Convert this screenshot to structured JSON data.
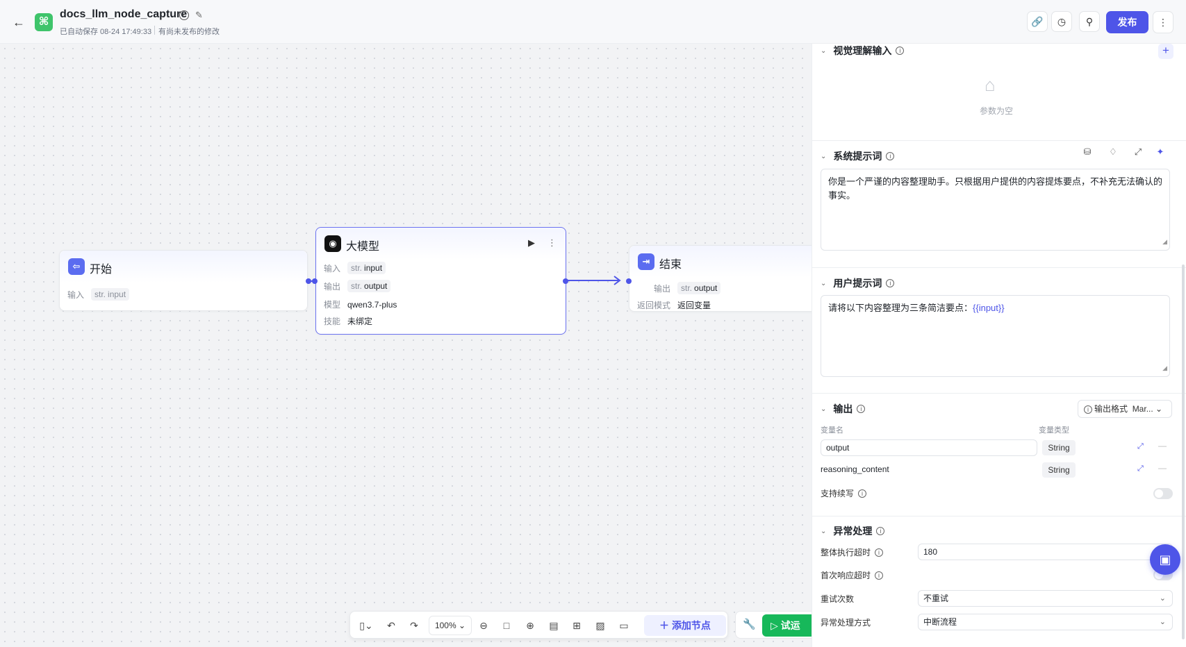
{
  "header": {
    "title": "docs_llm_node_capture",
    "save_status": "已自动保存 08-24 17:49:33",
    "unpublished": "有尚未发布的修改",
    "publish_label": "发布"
  },
  "nodes": {
    "start": {
      "title": "开始",
      "input_label": "输入",
      "input_type": "str.",
      "input_name": "input"
    },
    "llm": {
      "title": "大模型",
      "input_label": "输入",
      "input_type": "str.",
      "input_name": "input",
      "output_label": "输出",
      "output_type": "str.",
      "output_name": "output",
      "model_label": "模型",
      "model_value": "qwen3.7-plus",
      "skill_label": "技能",
      "skill_value": "未绑定"
    },
    "end": {
      "title": "结束",
      "output_label": "输出",
      "output_type": "str.",
      "output_name": "output",
      "mode_label": "返回模式",
      "mode_value": "返回变量"
    }
  },
  "toolbar": {
    "zoom": "100%",
    "add_node_label": "添加节点",
    "run_label": "试运"
  },
  "panel": {
    "vision": {
      "title": "视觉理解输入",
      "empty_text": "参数为空"
    },
    "system_prompt": {
      "title": "系统提示词",
      "text": "你是一个严谨的内容整理助手。只根据用户提供的内容提炼要点，不补充无法确认的事实。"
    },
    "user_prompt": {
      "title": "用户提示词",
      "text": "请将以下内容整理为三条简洁要点：",
      "var_ref": "{{input}}"
    },
    "output": {
      "title": "输出",
      "format_label": "输出格式",
      "format_value": "Mar...",
      "col_name": "变量名",
      "col_type": "变量类型",
      "vars": [
        {
          "name": "output",
          "type": "String"
        },
        {
          "name": "reasoning_content",
          "type": "String"
        }
      ],
      "stream_label": "支持续写"
    },
    "exception": {
      "title": "异常处理",
      "timeout_label": "整体执行超时",
      "timeout_value": "180",
      "first_resp_label": "首次响应超时",
      "retry_label": "重试次数",
      "retry_value": "不重试",
      "handle_label": "异常处理方式",
      "handle_value": "中断流程"
    }
  },
  "colors": {
    "accent": "#4e55e8",
    "run": "#17b85a",
    "logo": "#3fc46b"
  }
}
